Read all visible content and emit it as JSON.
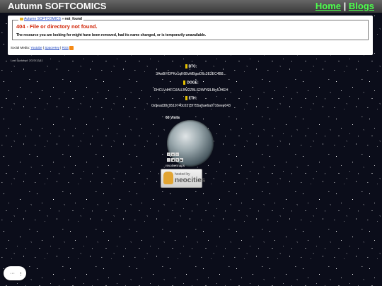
{
  "header": {
    "site_title": "Autumn SOFTCOMICS",
    "nav_home": "Home",
    "nav_separator": "|",
    "nav_blogs": "Blogs"
  },
  "panel": {
    "breadcrumb_home": "Autumn SOFTCOMICS",
    "breadcrumb_sep": "»",
    "breadcrumb_current": "not_found",
    "error_title": "404 - File or directory not found.",
    "error_message": "The resource you are looking for might have been removed, had its name changed, or is temporarily unavailable.",
    "social_label": "Social Media:",
    "social_youtube": "Youtube",
    "social_spacehey": "SpaceHey",
    "social_rss": "RSS"
  },
  "last_updated": "Last Updated: 2023/12/11",
  "crypto": {
    "btc_label": "BTC:",
    "btc_address": "3AwBiYDPKx1qK6BvMBgwD6c3E3EC4B8...",
    "doge_label": "DOGE:",
    "doge_address": "DHCLVdHFCXAUJWi2ZBLS2WfYRLBiy5JHEH",
    "eth_label": "ETH:",
    "eth_address": "0x9ead38c9519740c0375f755a0ae6a0716eee043"
  },
  "visits": "60 Visits",
  "revolvermaps": "revolvermaps",
  "neocities": {
    "small": "hosted by",
    "big": "neocities"
  },
  "colors": {
    "link_green": "#4cff4c",
    "error_red": "#d02000",
    "link_blue": "#2046c0"
  }
}
